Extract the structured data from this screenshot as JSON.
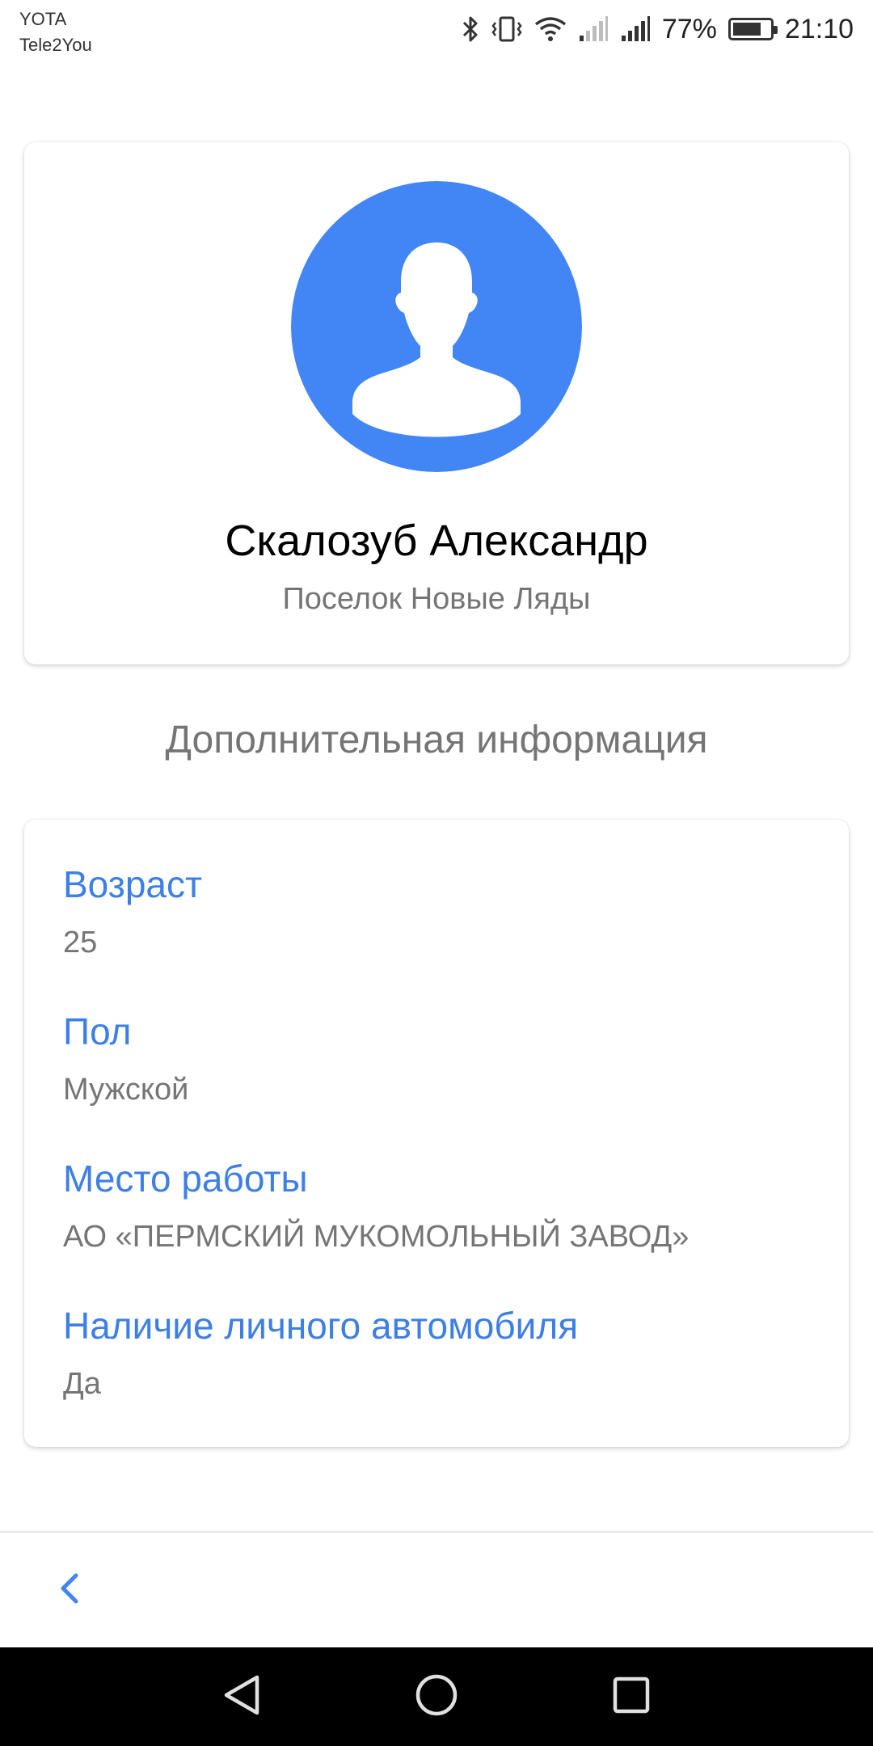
{
  "status_bar": {
    "carrier_1": "YOTA",
    "carrier_2": "Tele2You",
    "battery_percent": "77%",
    "battery_level": 0.77,
    "time": "21:10",
    "icons": [
      "bluetooth-icon",
      "vibrate-icon",
      "wifi-icon",
      "signal-icon",
      "signal-icon"
    ]
  },
  "profile": {
    "name": "Скалозуб Александр",
    "location": "Поселок Новые Ляды",
    "avatar_icon": "person-silhouette-icon"
  },
  "section": {
    "title": "Дополнительная информация"
  },
  "details": [
    {
      "label": "Возраст",
      "value": "25"
    },
    {
      "label": "Пол",
      "value": "Мужской"
    },
    {
      "label": "Место работы",
      "value": "АО «ПЕРМСКИЙ МУКОМОЛЬНЫЙ ЗАВОД»"
    },
    {
      "label": "Наличие личного автомобиля",
      "value": "Да"
    }
  ],
  "navigation": {
    "back_icon": "chevron-left-icon",
    "system_buttons": [
      "back-triangle-icon",
      "home-circle-icon",
      "recents-square-icon"
    ]
  },
  "colors": {
    "accent": "#4285F4",
    "label": "#3D7FE6",
    "secondary_text": "#757575",
    "nav_bar": "#000000"
  }
}
